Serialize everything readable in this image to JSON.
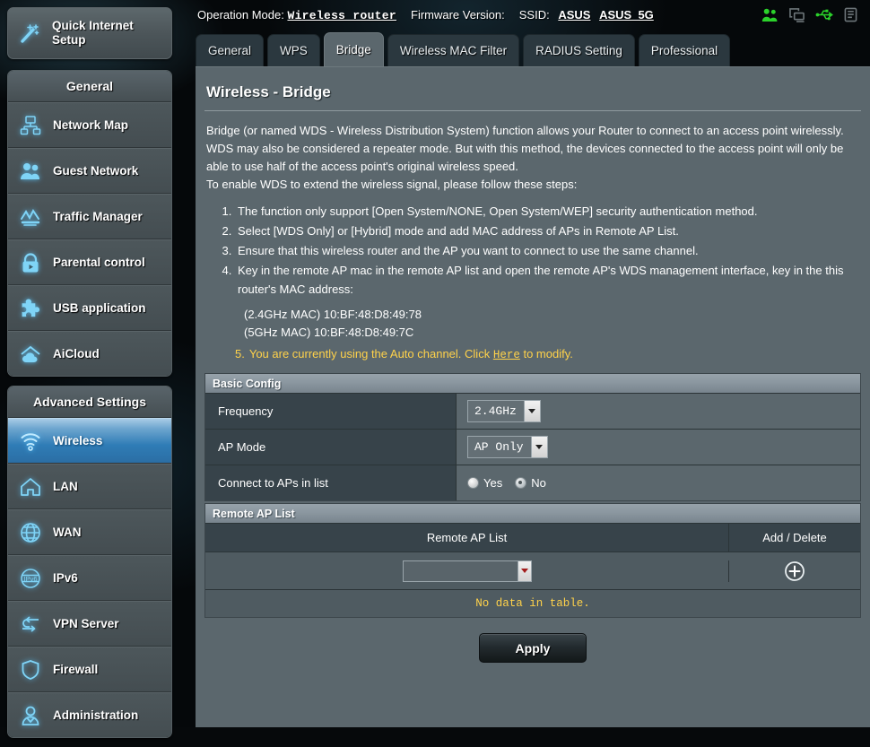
{
  "topbar": {
    "operation_mode_label": "Operation Mode:",
    "operation_mode_value": "Wireless router",
    "firmware_label": "Firmware Version:",
    "firmware_value": "",
    "ssid_label": "SSID:",
    "ssid_1": "ASUS",
    "ssid_2": "ASUS_5G",
    "icons": [
      "guest-users-icon",
      "client-devices-icon",
      "usb-icon",
      "printer-icon"
    ],
    "icon_colors": {
      "active": "#2bd22b",
      "inactive": "#6d7579"
    }
  },
  "sidebar": {
    "quick_setup": {
      "label": "Quick Internet Setup",
      "icon": "magic-wand-icon"
    },
    "general_header": "General",
    "general_items": [
      {
        "label": "Network Map",
        "icon": "network-map-icon"
      },
      {
        "label": "Guest Network",
        "icon": "guest-network-icon"
      },
      {
        "label": "Traffic Manager",
        "icon": "traffic-manager-icon"
      },
      {
        "label": "Parental control",
        "icon": "padlock-icon"
      },
      {
        "label": "USB application",
        "icon": "puzzle-piece-icon"
      },
      {
        "label": "AiCloud",
        "icon": "aicloud-icon"
      }
    ],
    "advanced_header": "Advanced Settings",
    "advanced_items": [
      {
        "label": "Wireless",
        "icon": "wifi-icon",
        "active": true
      },
      {
        "label": "LAN",
        "icon": "house-icon",
        "active": false
      },
      {
        "label": "WAN",
        "icon": "globe-icon",
        "active": false
      },
      {
        "label": "IPv6",
        "icon": "ipv6-globe-icon",
        "active": false
      },
      {
        "label": "VPN Server",
        "icon": "vpn-arrows-icon",
        "active": false
      },
      {
        "label": "Firewall",
        "icon": "shield-icon",
        "active": false
      },
      {
        "label": "Administration",
        "icon": "user-icon",
        "active": false
      }
    ]
  },
  "tabs": [
    {
      "label": "General",
      "active": false
    },
    {
      "label": "WPS",
      "active": false
    },
    {
      "label": "Bridge",
      "active": true
    },
    {
      "label": "Wireless MAC Filter",
      "active": false
    },
    {
      "label": "RADIUS Setting",
      "active": false
    },
    {
      "label": "Professional",
      "active": false
    }
  ],
  "page": {
    "title": "Wireless - Bridge",
    "intro_p1": "Bridge (or named WDS - Wireless Distribution System) function allows your Router to connect to an access point wirelessly. WDS may also be considered a repeater mode. But with this method, the devices connected to the access point will only be able to use half of the access point's original wireless speed.",
    "intro_p2": "To enable WDS to extend the wireless signal, please follow these steps:",
    "steps": [
      "The function only support [Open System/NONE, Open System/WEP] security authentication method.",
      "Select [WDS Only] or [Hybrid] mode and add MAC address of APs in Remote AP List.",
      "Ensure that this wireless router and the AP you want to connect to use the same channel.",
      "Key in the remote AP mac in the remote AP list and open the remote AP's WDS management interface, key in the this router's MAC address:"
    ],
    "mac_24": "(2.4GHz MAC) 10:BF:48:D8:49:78",
    "mac_5": "(5GHz MAC) 10:BF:48:D8:49:7C",
    "note_number": "5.",
    "note_before": "You are currently using the Auto channel. Click",
    "note_link": "Here",
    "note_after": "to modify.",
    "note_color": "#ffd24a"
  },
  "basic_config": {
    "header": "Basic Config",
    "rows": [
      {
        "label": "Frequency",
        "type": "select",
        "value": "2.4GHz"
      },
      {
        "label": "AP Mode",
        "type": "select",
        "value": "AP Only"
      },
      {
        "label": "Connect to APs in list",
        "type": "radio",
        "options": [
          "Yes",
          "No"
        ],
        "selected": "No"
      }
    ]
  },
  "remote_ap_list": {
    "header": "Remote AP List",
    "col_list": "Remote AP List",
    "col_action": "Add / Delete",
    "row_value": "",
    "add_icon": "plus-circle-icon",
    "empty_text": "No data in table."
  },
  "apply": {
    "label": "Apply"
  }
}
